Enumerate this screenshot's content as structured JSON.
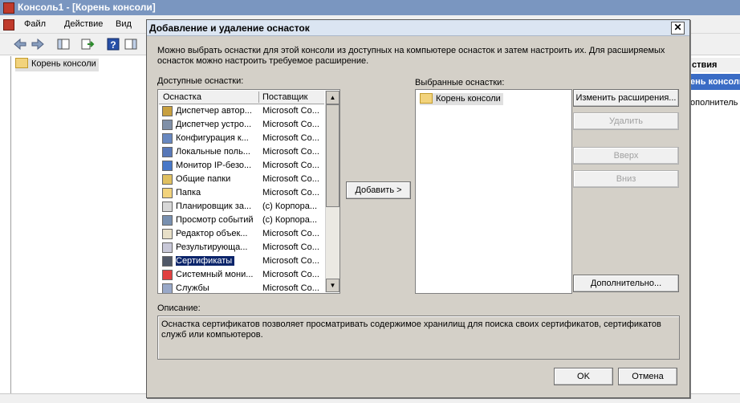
{
  "mmc": {
    "title": "Консоль1 - [Корень консоли]",
    "menu": [
      "Файл",
      "Действие",
      "Вид"
    ],
    "tree_root": "Корень консоли",
    "actions_header": "ствия",
    "actions_selected": "ень консоли",
    "actions_more": "ополнитель"
  },
  "dialog": {
    "title": "Добавление и удаление оснасток",
    "close_glyph": "✕",
    "intro": "Можно выбрать оснастки для этой консоли из доступных на компьютере оснасток и затем настроить их. Для расширяемых оснасток можно настроить требуемое расширение.",
    "available_label": "Доступные оснастки:",
    "selected_label": "Выбранные оснастки:",
    "col_snapin": "Оснастка",
    "col_vendor": "Поставщик",
    "snapins": [
      {
        "name": "Диспетчер автор...",
        "vendor": "Microsoft Co...",
        "icon": "authorization-manager-icon",
        "color": "#c8a040"
      },
      {
        "name": "Диспетчер устро...",
        "vendor": "Microsoft Co...",
        "icon": "device-manager-icon",
        "color": "#8090a8"
      },
      {
        "name": "Конфигурация к...",
        "vendor": "Microsoft Co...",
        "icon": "computer-config-icon",
        "color": "#6888c0"
      },
      {
        "name": "Локальные поль...",
        "vendor": "Microsoft Co...",
        "icon": "local-users-icon",
        "color": "#5878b8"
      },
      {
        "name": "Монитор IP-безо...",
        "vendor": "Microsoft Co...",
        "icon": "ipsec-monitor-icon",
        "color": "#4878c8"
      },
      {
        "name": "Общие папки",
        "vendor": "Microsoft Co...",
        "icon": "shared-folders-icon",
        "color": "#e0c060"
      },
      {
        "name": "Папка",
        "vendor": "Microsoft Co...",
        "icon": "folder-icon",
        "color": "#f2d37c"
      },
      {
        "name": "Планировщик за...",
        "vendor": "(c) Корпора...",
        "icon": "task-scheduler-icon",
        "color": "#d8d8d8"
      },
      {
        "name": "Просмотр событий",
        "vendor": "(c) Корпора...",
        "icon": "event-viewer-icon",
        "color": "#7890b0"
      },
      {
        "name": "Редактор объек...",
        "vendor": "Microsoft Co...",
        "icon": "object-editor-icon",
        "color": "#e8e0c8"
      },
      {
        "name": "Результирующа...",
        "vendor": "Microsoft Co...",
        "icon": "resultant-policy-icon",
        "color": "#c8c8d8"
      },
      {
        "name": "Сертификаты",
        "vendor": "Microsoft Co...",
        "icon": "certificates-icon",
        "color": "#505868",
        "selected": true
      },
      {
        "name": "Системный мони...",
        "vendor": "Microsoft Co...",
        "icon": "system-monitor-icon",
        "color": "#e04040"
      },
      {
        "name": "Службы",
        "vendor": "Microsoft Co...",
        "icon": "services-icon",
        "color": "#98a8c8"
      }
    ],
    "add_button": "Добавить >",
    "selected_items": [
      "Корень консоли"
    ],
    "btn_edit_ext": "Изменить расширения...",
    "btn_remove": "Удалить",
    "btn_up": "Вверх",
    "btn_down": "Вниз",
    "btn_advanced": "Дополнительно...",
    "description_label": "Описание:",
    "description": "Оснастка сертификатов позволяет просматривать содержимое хранилищ для поиска своих сертификатов, сертификатов служб или компьютеров.",
    "btn_ok": "OK",
    "btn_cancel": "Отмена"
  }
}
